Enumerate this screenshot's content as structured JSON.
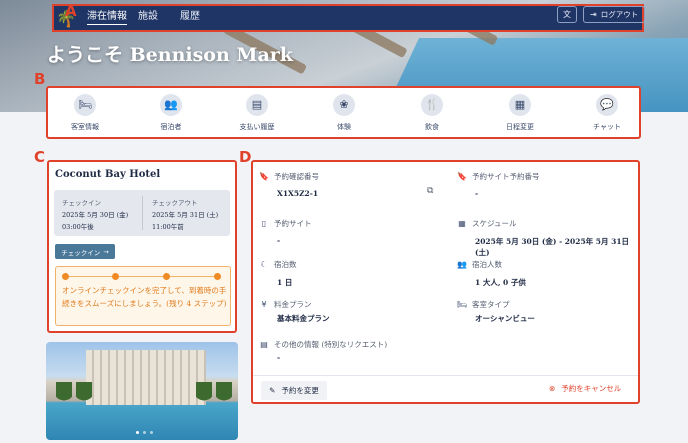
{
  "nav": {
    "links": [
      "滞在情報",
      "施設",
      "履歴"
    ],
    "lang_icon": "translate-icon",
    "logout_label": "ログアウト"
  },
  "callouts": [
    "A",
    "B",
    "C",
    "D"
  ],
  "welcome": "ようこそ Bennison Mark",
  "quick_menu": [
    {
      "label": "客室情報",
      "icon": "bed-icon"
    },
    {
      "label": "宿泊者",
      "icon": "guests-icon"
    },
    {
      "label": "支払い履歴",
      "icon": "receipt-icon"
    },
    {
      "label": "体験",
      "icon": "lotus-icon"
    },
    {
      "label": "飲食",
      "icon": "dining-icon"
    },
    {
      "label": "日程変更",
      "icon": "calendar-icon"
    },
    {
      "label": "チャット",
      "icon": "chat-icon"
    }
  ],
  "hotel": {
    "name": "Coconut Bay Hotel",
    "checkin_label": "チェックイン",
    "checkin_date": "2025年 5月 30日 (金)",
    "checkin_time": "03:00午後",
    "checkout_label": "チェックアウト",
    "checkout_date": "2025年 5月 31日 (土)",
    "checkout_time": "11:00午前",
    "checkin_button": "チェックイン",
    "online_checkin_steps_total": 4,
    "online_checkin_message": "オンラインチェックインを完了して、到着時の手続きをスムーズにしましょう。(残り 4 ステップ)"
  },
  "reservation": {
    "confirmation_label": "予約確認番号",
    "confirmation_value": "X1X5Z2-1",
    "site_number_label": "予約サイト予約番号",
    "site_number_value": "-",
    "site_label": "予約サイト",
    "site_value": "-",
    "schedule_label": "スケジュール",
    "schedule_value": "2025年 5月 30日 (金) - 2025年 5月 31日 (土)",
    "nights_label": "宿泊数",
    "nights_value": "1 日",
    "guests_label": "宿泊人数",
    "guests_value": "1 大人, 0 子供",
    "plan_label": "料金プラン",
    "plan_value": "基本料金プラン",
    "room_type_label": "客室タイプ",
    "room_type_value": "オーシャンビュー",
    "other_label": "その他の情報 (特別なリクエスト)",
    "other_value": "-",
    "change_button": "予約を変更",
    "cancel_button": "予約をキャンセル"
  },
  "colors": {
    "nav_bg": "#1f3566",
    "annotation": "#e0412b",
    "checkin_button": "#4a7899",
    "online_checkin_accent": "#f08a24"
  }
}
